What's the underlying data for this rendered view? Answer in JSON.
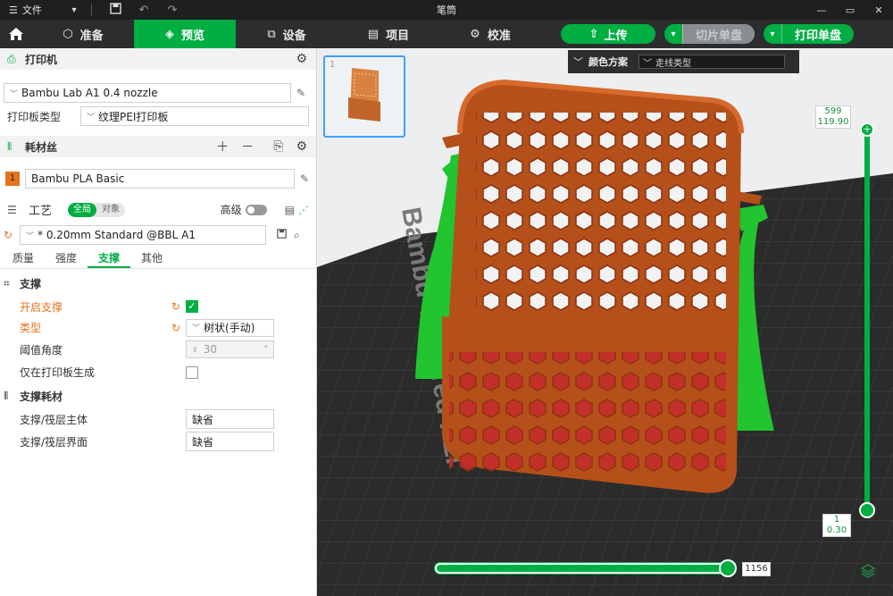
{
  "titlebar": {
    "file_label": "文件",
    "title": "笔筒"
  },
  "nav": {
    "tabs": [
      {
        "label": "准备",
        "icon": "cube-icon"
      },
      {
        "label": "预览",
        "icon": "layers-icon"
      },
      {
        "label": "设备",
        "icon": "device-icon"
      },
      {
        "label": "项目",
        "icon": "project-icon"
      },
      {
        "label": "校准",
        "icon": "calibrate-icon"
      }
    ],
    "upload_label": "上传",
    "slice_plate_label": "切片单盘",
    "print_plate_label": "打印单盘"
  },
  "printer": {
    "section_title": "打印机",
    "printer_name": "Bambu Lab A1 0.4 nozzle",
    "plate_type_label": "打印板类型",
    "plate_type_value": "纹理PEI打印板"
  },
  "filament": {
    "section_title": "耗材丝",
    "slots": [
      {
        "index": "1",
        "name": "Bambu PLA Basic",
        "color": "#e4731f"
      }
    ]
  },
  "process": {
    "section_title": "工艺",
    "scope_global": "全局",
    "scope_object": "对象",
    "advanced_label": "高级",
    "preset": "* 0.20mm Standard @BBL A1",
    "tabs": [
      "质量",
      "强度",
      "支撑",
      "其他"
    ],
    "active_tab": "支撑"
  },
  "support": {
    "group_title": "支撑",
    "enable_label": "开启支撑",
    "enable_value": true,
    "type_label": "类型",
    "type_value": "树状(手动)",
    "threshold_label": "阈值角度",
    "threshold_value": "30",
    "threshold_unit": "°",
    "build_plate_only_label": "仅在打印板生成",
    "build_plate_only_value": false
  },
  "support_filament": {
    "group_title": "支撑耗材",
    "base_label": "支撑/筏层主体",
    "base_value": "缺省",
    "interface_label": "支撑/筏层界面",
    "interface_value": "缺省"
  },
  "viewport": {
    "plate_number": "1",
    "legend_title": "颜色方案",
    "legend_value": "走线类型",
    "bed_brand_text": "Bambu Textured PEI",
    "layer_top_index": "599",
    "layer_top_height": "119.90",
    "layer_bottom_index": "1",
    "layer_bottom_height": "0.30",
    "move_value": "1156",
    "colors": {
      "model": "#b5501a",
      "support": "#22c42f",
      "bed": "#2b2b2b",
      "accent": "#00ae42"
    }
  }
}
